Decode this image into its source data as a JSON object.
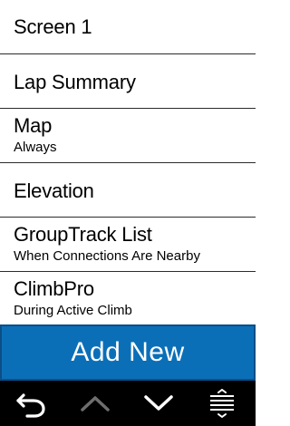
{
  "list": {
    "items": [
      {
        "title": "Screen 1",
        "subtitle": ""
      },
      {
        "title": "Lap Summary",
        "subtitle": ""
      },
      {
        "title": "Map",
        "subtitle": "Always"
      },
      {
        "title": "Elevation",
        "subtitle": ""
      },
      {
        "title": "GroupTrack List",
        "subtitle": "When Connections Are Nearby"
      },
      {
        "title": "ClimbPro",
        "subtitle": "During Active Climb"
      }
    ]
  },
  "add_button": {
    "label": "Add New"
  },
  "navbar": {
    "icons": [
      "back-arrow-icon",
      "chevron-up-icon",
      "chevron-down-icon",
      "menu-lines-icon"
    ],
    "colors": {
      "active": "#ffffff",
      "disabled": "#6e6e6e"
    }
  },
  "colors": {
    "accent": "#0b6fb8",
    "background": "#ffffff",
    "navbar": "#000000"
  }
}
